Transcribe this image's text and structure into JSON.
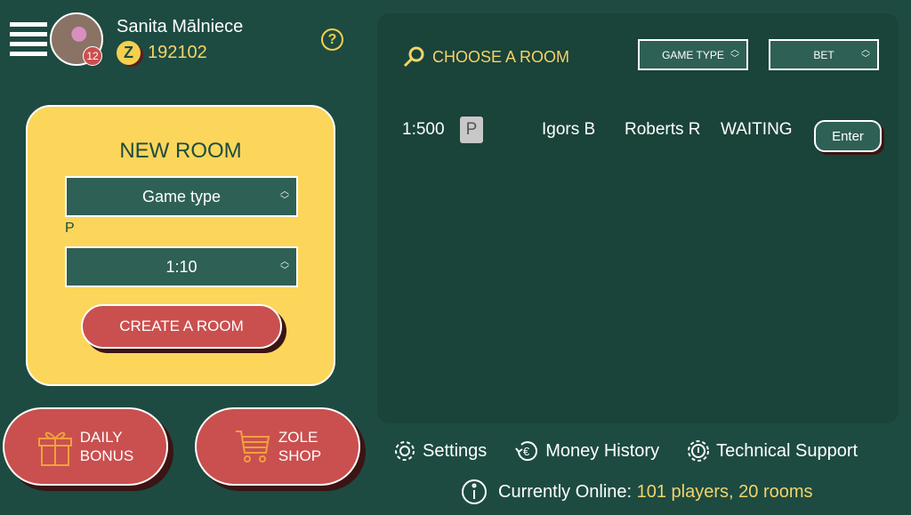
{
  "header": {
    "user_name": "Sanita Mālniece",
    "notification_count": "12",
    "balance": "192102",
    "coin_letter": "Z",
    "help": "?"
  },
  "new_room": {
    "title": "NEW ROOM",
    "game_type": "Game type",
    "type_label": "P",
    "bet": "1:10",
    "create_label": "CREATE A ROOM"
  },
  "actions": {
    "daily_bonus": [
      "DAILY",
      "BONUS"
    ],
    "shop": [
      "ZOLE",
      "SHOP"
    ]
  },
  "rooms": {
    "title": "CHOOSE A ROOM",
    "filter_game_type": "GAME TYPE",
    "filter_bet": "BET",
    "list": [
      {
        "bet": "1:500",
        "type": "P",
        "player1": "Igors B",
        "player2": "Roberts R",
        "status": "WAITING",
        "action": "Enter"
      }
    ]
  },
  "footer": {
    "settings": "Settings",
    "money_history": "Money History",
    "support": "Technical Support",
    "online_label": "Currently Online:",
    "online_value": "101 players, 20 rooms"
  },
  "colors": {
    "background": "#1d4b41",
    "accent_yellow": "#fcd65a",
    "button_red": "#c9504f"
  }
}
